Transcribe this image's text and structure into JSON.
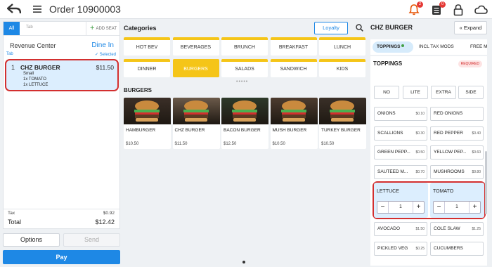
{
  "header": {
    "title": "Order 10900003",
    "notif_badge": "2",
    "orders_badge": "0"
  },
  "left": {
    "tab_all": "All",
    "tab_placeholder": "Tab",
    "add_seat": "ADD SEAT",
    "revenue_center": "Revenue Center",
    "dine_in": "Dine In",
    "tab_label": "Tab",
    "selected_label": "Selected",
    "item": {
      "num": "1",
      "name": "CHZ BURGER",
      "price": "$11.50",
      "size": "Small",
      "mods": [
        "1x TOMATO",
        "1x LETTUCE"
      ]
    },
    "tax_label": "Tax",
    "tax_value": "$0.92",
    "total_label": "Total",
    "total_value": "$12.42",
    "options": "Options",
    "send": "Send",
    "pay": "Pay"
  },
  "middle": {
    "categories_title": "Categories",
    "loyalty": "Loyalty",
    "categories": [
      "HOT BEV",
      "BEVERAGES",
      "BRUNCH",
      "BREAKFAST",
      "LUNCH",
      "DINNER",
      "BURGERS",
      "SALADS",
      "SANDWICH",
      "KIDS"
    ],
    "active_category": "BURGERS",
    "page_dots": "•••••",
    "burgers_title": "BURGERS",
    "products": [
      {
        "name": "HAMBURGER",
        "price": "$10.50"
      },
      {
        "name": "CHZ BURGER",
        "price": "$11.50"
      },
      {
        "name": "BACON BURGER",
        "price": "$12.50"
      },
      {
        "name": "MUSH BURGER",
        "price": "$10.50"
      },
      {
        "name": "TURKEY BURGER",
        "price": "$10.50"
      }
    ]
  },
  "right": {
    "title": "CHZ BURGER",
    "expand": "Expand",
    "tabs": [
      "TOPPINGS",
      "INCL TAX MODS",
      "FREE M"
    ],
    "section": "TOPPINGS",
    "required": "REQUIRED",
    "quantity_buttons": [
      "NO",
      "LITE",
      "EXTRA",
      "SIDE"
    ],
    "mods": [
      {
        "name": "ONIONS",
        "price": "$0.10"
      },
      {
        "name": "RED ONIONS",
        "price": ""
      },
      {
        "name": "SCALLIONS",
        "price": "$0.30"
      },
      {
        "name": "RED PEPPER",
        "price": "$0.40"
      },
      {
        "name": "GREEN PEPP...",
        "price": "$0.50"
      },
      {
        "name": "YELLOW PEP...",
        "price": "$0.60"
      },
      {
        "name": "SAUTEED M...",
        "price": "$0.70"
      },
      {
        "name": "MUSHROOMS",
        "price": "$0.80"
      }
    ],
    "selected": [
      {
        "name": "LETTUCE",
        "qty": "1"
      },
      {
        "name": "TOMATO",
        "qty": "1"
      }
    ],
    "mods_bottom": [
      {
        "name": "AVOCADO",
        "price": "$1.50"
      },
      {
        "name": "COLE SLAW",
        "price": "$1.25"
      },
      {
        "name": "PICKLED VEG",
        "price": "$0.25"
      },
      {
        "name": "CUCUMBERS",
        "price": ""
      }
    ]
  },
  "colors": {
    "accent": "#1e88e5",
    "category_yellow": "#f5c518",
    "selection_red": "#d32f2f",
    "selected_bg": "#dceefe"
  }
}
